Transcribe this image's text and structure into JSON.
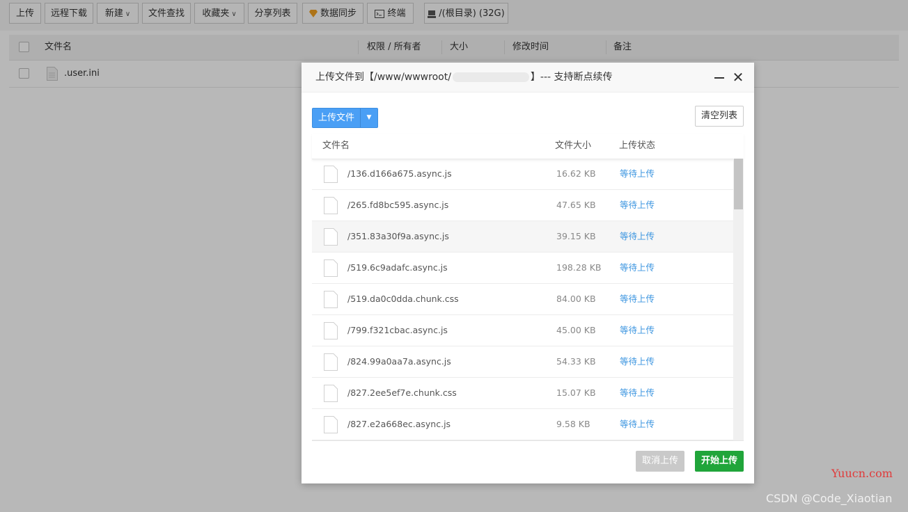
{
  "toolbar": {
    "upload": "上传",
    "remote_download": "远程下载",
    "new": "新建",
    "file_search": "文件查找",
    "favorites": "收藏夹",
    "share_list": "分享列表",
    "data_sync": "数据同步",
    "terminal": "终端",
    "path": "/(根目录) (32G)"
  },
  "table": {
    "columns": [
      "文件名",
      "权限 / 所有者",
      "大小",
      "修改时间",
      "备注"
    ],
    "rows": [
      {
        "name": ".user.ini"
      }
    ]
  },
  "dialog": {
    "title_prefix": "上传文件到【/www/wwwroot/",
    "title_suffix": "】--- 支持断点续传",
    "upload_button": "上传文件",
    "clear_button": "清空列表",
    "columns": {
      "name": "文件名",
      "size": "文件大小",
      "status": "上传状态"
    },
    "files": [
      {
        "name": "/136.d166a675.async.js",
        "size": "16.62 KB",
        "status": "等待上传"
      },
      {
        "name": "/265.fd8bc595.async.js",
        "size": "47.65 KB",
        "status": "等待上传"
      },
      {
        "name": "/351.83a30f9a.async.js",
        "size": "39.15 KB",
        "status": "等待上传"
      },
      {
        "name": "/519.6c9adafc.async.js",
        "size": "198.28 KB",
        "status": "等待上传"
      },
      {
        "name": "/519.da0c0dda.chunk.css",
        "size": "84.00 KB",
        "status": "等待上传"
      },
      {
        "name": "/799.f321cbac.async.js",
        "size": "45.00 KB",
        "status": "等待上传"
      },
      {
        "name": "/824.99a0aa7a.async.js",
        "size": "54.33 KB",
        "status": "等待上传"
      },
      {
        "name": "/827.2ee5ef7e.chunk.css",
        "size": "15.07 KB",
        "status": "等待上传"
      },
      {
        "name": "/827.e2a668ec.async.js",
        "size": "9.58 KB",
        "status": "等待上传"
      }
    ],
    "cancel_button": "取消上传",
    "start_button": "开始上传"
  },
  "watermarks": {
    "site": "Yuucn.com",
    "author": "CSDN @Code_Xiaotian"
  },
  "colors": {
    "primary_blue": "#4a9ff5",
    "success_green": "#20a53a",
    "status_blue": "#3d96e0"
  }
}
